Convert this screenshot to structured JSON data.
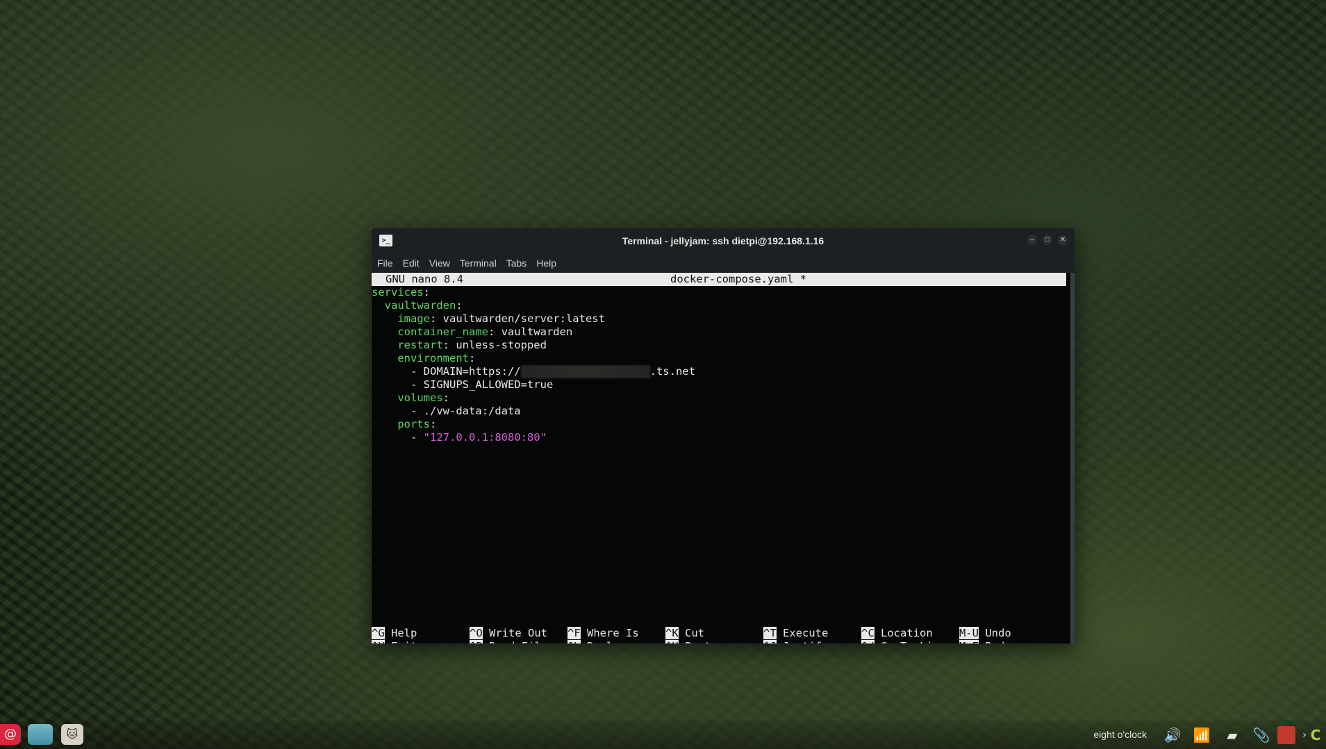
{
  "window": {
    "title": "Terminal - jellyjam: ssh dietpi@192.168.1.16",
    "icon_text": ">_",
    "menu": [
      "File",
      "Edit",
      "View",
      "Terminal",
      "Tabs",
      "Help"
    ]
  },
  "nano": {
    "version": "GNU nano 8.4",
    "filename": "docker-compose.yaml *"
  },
  "file_lines": [
    {
      "indent": "",
      "key": "services",
      "rest": ":"
    },
    {
      "indent": "  ",
      "key": "vaultwarden",
      "rest": ":"
    },
    {
      "indent": "    ",
      "key": "image",
      "rest": ": vaultwarden/server:latest"
    },
    {
      "indent": "    ",
      "key": "container_name",
      "rest": ": vaultwarden"
    },
    {
      "indent": "    ",
      "key": "restart",
      "rest": ": unless-stopped"
    },
    {
      "indent": "    ",
      "key": "environment",
      "rest": ":"
    },
    {
      "indent": "      ",
      "plain_before": "- DOMAIN=https://",
      "redacted": true,
      "plain_after": ".ts.net"
    },
    {
      "indent": "      ",
      "plain_before": "- SIGNUPS_ALLOWED=true"
    },
    {
      "indent": "    ",
      "key": "volumes",
      "rest": ":"
    },
    {
      "indent": "      ",
      "plain_before": "- ./vw-data:/data"
    },
    {
      "indent": "    ",
      "key": "ports",
      "rest": ":"
    },
    {
      "indent": "      ",
      "plain_before": "- ",
      "string": "\"127.0.0.1:8080:80\""
    }
  ],
  "shortcuts": {
    "row1": [
      {
        "key": "^G",
        "label": "Help"
      },
      {
        "key": "^O",
        "label": "Write Out"
      },
      {
        "key": "^F",
        "label": "Where Is"
      },
      {
        "key": "^K",
        "label": "Cut"
      },
      {
        "key": "^T",
        "label": "Execute"
      },
      {
        "key": "^C",
        "label": "Location"
      },
      {
        "key": "M-U",
        "label": "Undo"
      }
    ],
    "row2": [
      {
        "key": "^X",
        "label": "Exit"
      },
      {
        "key": "^R",
        "label": "Read File"
      },
      {
        "key": "^\\",
        "label": "Replace"
      },
      {
        "key": "^U",
        "label": "Paste"
      },
      {
        "key": "^J",
        "label": "Justify"
      },
      {
        "key": "^/",
        "label": "Go To Line"
      },
      {
        "key": "M-E",
        "label": "Redo"
      }
    ]
  },
  "taskbar": {
    "clock": "eight o'clock",
    "apps": [
      "debian-menu-icon",
      "file-manager-icon",
      "cat-app-icon"
    ],
    "tray": [
      "volume-icon",
      "network-icon",
      "notes-icon",
      "clip-icon",
      "app-tray-icon",
      "chevron-right-icon",
      "updater-icon"
    ]
  },
  "colors": {
    "yaml_key": "#5fd75f",
    "yaml_string": "#d75fd7",
    "nano_header_bg": "#e9e9e9",
    "terminal_bg": "#050606"
  }
}
